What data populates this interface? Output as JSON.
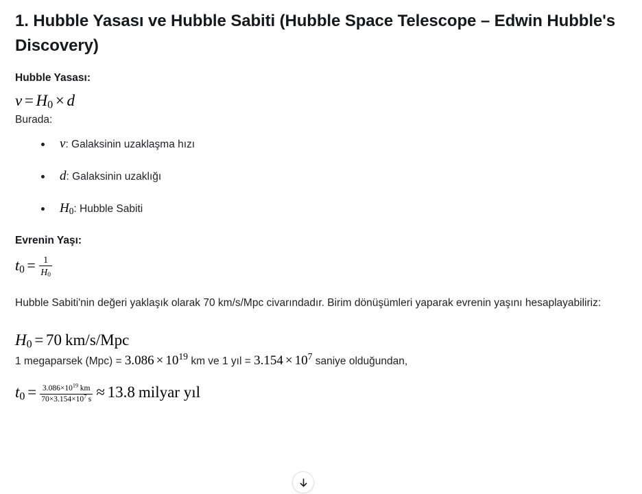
{
  "document": {
    "title": "1. Hubble Yasası ve Hubble Sabiti (Hubble Space Telescope – Edwin Hubble's Discovery)",
    "sections": {
      "law": {
        "heading": "Hubble Yasası:",
        "equation_plain": "v = H0 × d",
        "equation_parts": {
          "lhs": "v",
          "eq": "=",
          "H": "H",
          "H_sub": "0",
          "times": "×",
          "d": "d"
        },
        "intro": "Burada:",
        "definitions": [
          {
            "symbol": "v",
            "symbol_sub": "",
            "text": ": Galaksinin uzaklaşma hızı"
          },
          {
            "symbol": "d",
            "symbol_sub": "",
            "text": ": Galaksinin uzaklığı"
          },
          {
            "symbol": "H",
            "symbol_sub": "0",
            "text": ": Hubble Sabiti"
          }
        ]
      },
      "age": {
        "heading": "Evrenin Yaşı:",
        "equation_plain": "t0 = 1 / H0",
        "equation_parts": {
          "t": "t",
          "t_sub": "0",
          "eq": "=",
          "num": "1",
          "den_H": "H",
          "den_sub": "0"
        },
        "paragraph": "Hubble Sabiti'nin değeri yaklaşık olarak 70 km/s/Mpc civarındadır. Birim dönüşümleri yaparak evrenin yaşını hesaplayabiliriz:"
      },
      "calculation": {
        "h0_value": {
          "H": "H",
          "H_sub": "0",
          "eq": "=",
          "value": "70",
          "unit": "km/s/Mpc",
          "plain": "H0 = 70 km/s/Mpc"
        },
        "conversion_line": {
          "part1": "1 megaparsek (Mpc) = ",
          "mant1": "3.086",
          "times1": "×",
          "base1": "10",
          "exp1": "19",
          "part2": " km ve 1 yıl = ",
          "mant2": "3.154",
          "times2": "×",
          "base2": "10",
          "exp2": "7",
          "part3": " saniye olduğundan,",
          "plain": "1 megaparsek (Mpc) = 3.086 × 10^19 km ve 1 yıl = 3.154 × 10^7 saniye olduğundan,"
        },
        "final_equation": {
          "t": "t",
          "t_sub": "0",
          "eq": "=",
          "num_mant": "3.086",
          "num_times": "×",
          "num_base": "10",
          "num_exp": "19",
          "num_unit": "km",
          "den_n": "70",
          "den_times1": "×",
          "den_mant": "3.154",
          "den_times2": "×",
          "den_base": "10",
          "den_exp": "7",
          "den_unit": "s",
          "approx": "≈",
          "result": "13.8",
          "result_unit": "milyar yıl",
          "plain": "t0 = (3.086×10^19 km) / (70×3.154×10^7 s) ≈ 13.8 milyar yıl"
        }
      }
    }
  },
  "controls": {
    "scroll_to_bottom": {
      "icon": "arrow-down-icon",
      "label": "Aşağı kaydır"
    }
  },
  "theme": {
    "background": "#ffffff",
    "text": "#1f2023",
    "heading": "#17181b",
    "math": "#000000",
    "fab_border": "#e3e3e3"
  }
}
